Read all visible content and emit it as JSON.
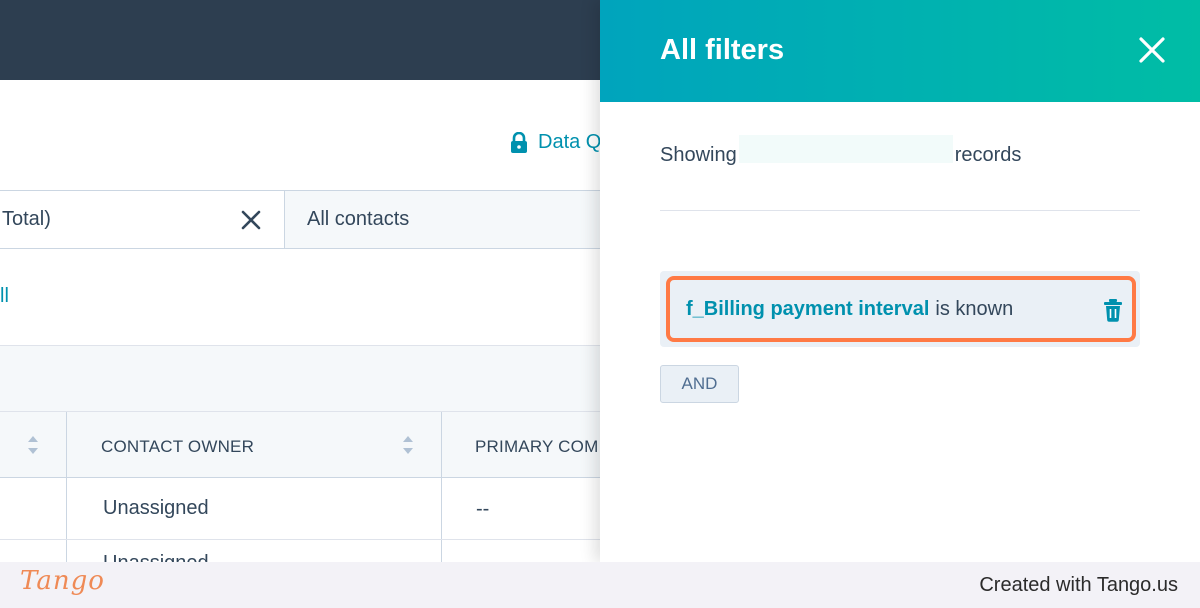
{
  "app": {
    "data_quality_label": "Data Q",
    "tabs": [
      {
        "label": "Total)",
        "active": true
      },
      {
        "label": "All contacts",
        "active": false
      }
    ],
    "view_all_link": "ll",
    "table": {
      "headers": [
        "CONTACT OWNER",
        "PRIMARY COM"
      ],
      "rows": [
        [
          "Unassigned",
          "--"
        ],
        [
          "Unassigned",
          ""
        ]
      ]
    }
  },
  "filter_panel": {
    "title": "All filters",
    "showing_prefix": "Showing",
    "showing_suffix": "records",
    "filters": [
      {
        "property": "f_Billing payment interval",
        "operator": "is known"
      }
    ],
    "and_button_label": "AND"
  },
  "footer": {
    "logo_text": "Tango",
    "credit_text": "Created with Tango.us"
  },
  "colors": {
    "nav": "#2d3e50",
    "panel_header_start": "#00a4bd",
    "panel_header_end": "#00bda5",
    "link": "#0091ae",
    "highlight": "#ff7a45",
    "text": "#33475b"
  },
  "icons": {
    "lock": "lock-icon",
    "tab_close": "close-icon",
    "sort": "sort-icon",
    "panel_close": "close-icon",
    "trash": "trash-icon"
  }
}
